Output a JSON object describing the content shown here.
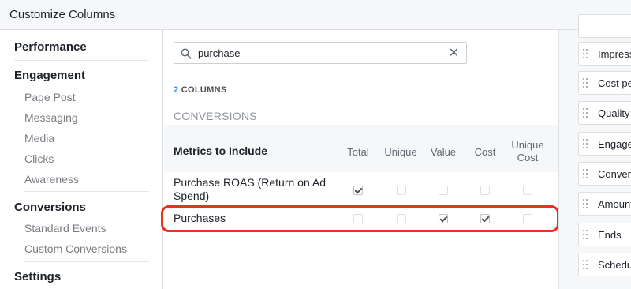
{
  "dialog": {
    "title": "Customize Columns"
  },
  "sidebar": {
    "sections": [
      {
        "label": "Performance",
        "items": []
      },
      {
        "label": "Engagement",
        "items": [
          "Page Post",
          "Messaging",
          "Media",
          "Clicks",
          "Awareness"
        ]
      },
      {
        "label": "Conversions",
        "items": [
          "Standard Events",
          "Custom Conversions"
        ]
      },
      {
        "label": "Settings",
        "items": []
      }
    ]
  },
  "search": {
    "value": "purchase",
    "clear_glyph": "✕"
  },
  "results": {
    "count": "2",
    "count_label": "COLUMNS",
    "group": "CONVERSIONS"
  },
  "table": {
    "metrics_header": "Metrics to Include",
    "columns": [
      "Total",
      "Unique",
      "Value",
      "Cost",
      "Unique Cost"
    ],
    "rows": [
      {
        "name": "Purchase ROAS (Return on Ad Spend)",
        "checked": [
          true,
          false,
          false,
          false,
          false
        ]
      },
      {
        "name": "Purchases",
        "checked": [
          false,
          false,
          true,
          true,
          false
        ]
      }
    ]
  },
  "selected_columns": [
    "Impress",
    "Cost pe",
    "Quality",
    "Engage",
    "Conver",
    "Amount",
    "Ends",
    "Schedu"
  ],
  "colors": {
    "accent": "#4080ff",
    "highlight": "#e8321f"
  }
}
